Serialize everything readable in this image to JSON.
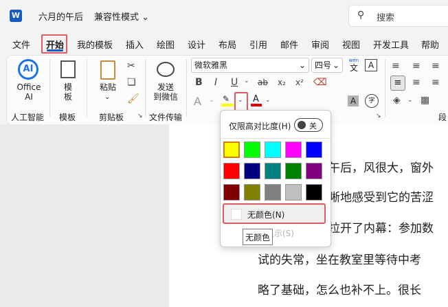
{
  "titlebar": {
    "logo": "W",
    "doc_title": "六月的午后",
    "mode": "兼容性模式 ⌄",
    "search_placeholder": "搜索",
    "search_icon": "search-icon"
  },
  "menu": [
    "文件",
    "开始",
    "我的模板",
    "插入",
    "绘图",
    "设计",
    "布局",
    "引用",
    "邮件",
    "审阅",
    "视图",
    "开发工具",
    "帮助"
  ],
  "ribbon": {
    "ai": {
      "icon_text": "AI",
      "label_line1": "Office",
      "label_line2": "AI",
      "group": "人工智能"
    },
    "template": {
      "label_line1": "模",
      "label_line2": "板",
      "group": "模板"
    },
    "clipboard": {
      "paste": "粘贴",
      "group": "剪贴板"
    },
    "wechat": {
      "label_line1": "发送",
      "label_line2": "到微信",
      "group": "文件传输"
    },
    "font": {
      "name": "微软雅黑",
      "size": "四号",
      "wen_top": "wén",
      "wen": "文",
      "a_box": "A",
      "bold": "B",
      "italic": "I",
      "underline": "U",
      "strike": "ab",
      "subscript": "x₂",
      "superscript": "x²",
      "a_grey": "A",
      "a_red": "A",
      "a_shaded": "A",
      "a_circle": "字",
      "expand": "↘"
    },
    "paragraph_group": "段"
  },
  "popup": {
    "high_contrast": "仅限高对比度(H)",
    "toggle": "关",
    "swatches": [
      "#ffff00",
      "#00ff00",
      "#00ffff",
      "#ff00ff",
      "#0000ff",
      "#ff0000",
      "#000080",
      "#008080",
      "#008000",
      "#800080",
      "#800000",
      "#808000",
      "#808080",
      "#c0c0c0",
      "#000000"
    ],
    "no_color": "无颜色(N)",
    "ghost": "显示(S)",
    "tooltip": "无颜色"
  },
  "document": {
    "lines": [
      "午后，风很大，窗外",
      "晰地感受到它的苦涩",
      "拉开了内幕：参加数",
      "试的失常，坐在教室里等待中考",
      "略了基础，怎么也补不上。很长"
    ]
  }
}
